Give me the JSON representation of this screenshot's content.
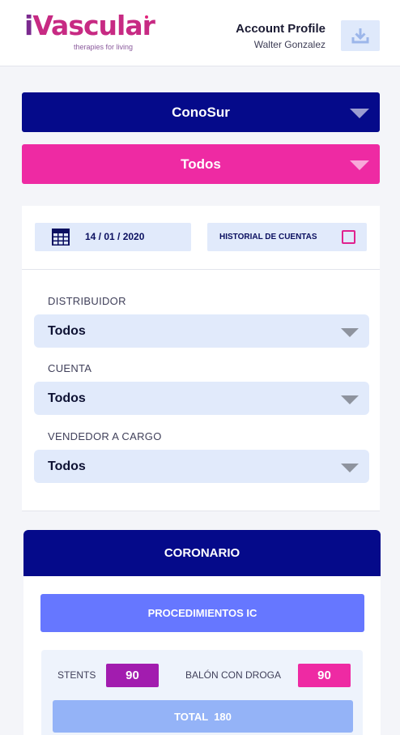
{
  "header": {
    "logo_i": "i",
    "logo_rest": "Vascular",
    "logo_tagline": "therapies for living",
    "profile_title": "Account Profile",
    "profile_name": "Walter Gonzalez",
    "download_icon": "download-icon"
  },
  "region_select": {
    "value": "ConoSur",
    "color": "#050a8a"
  },
  "group_select": {
    "value": "Todos",
    "color": "#ee2aa3"
  },
  "filters": {
    "date_icon": "calendar-icon",
    "date": "14 / 01 / 2020",
    "history_label": "HISTORIAL DE CUENTAS",
    "history_checked": false,
    "distribuidor": {
      "label": "DISTRIBUIDOR",
      "value": "Todos"
    },
    "cuenta": {
      "label": "CUENTA",
      "value": "Todos"
    },
    "vendedor": {
      "label": "VENDEDOR A CARGO",
      "value": "Todos"
    }
  },
  "coronario": {
    "title": "CORONARIO",
    "procedures_button": "PROCEDIMIENTOS IC",
    "stents_label": "STENTS",
    "stents_value": "90",
    "stents_color": "#a21caf",
    "balon_label": "BALÓN CON DROGA",
    "balon_value": "90",
    "balon_color": "#ee2aa3",
    "total_label": "TOTAL  180"
  }
}
